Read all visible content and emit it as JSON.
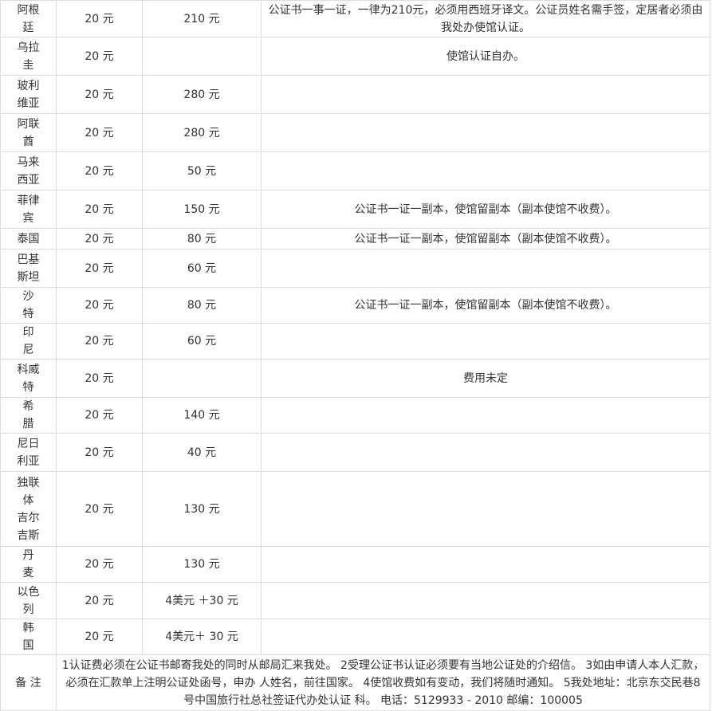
{
  "rows": [
    {
      "country": "阿根廷",
      "fee": "20 元",
      "embassy_fee": "210 元",
      "note": "公证书一事一证，一律为210元，必须用西班牙译文。公证员姓名需手签，定居者必须由我处办使馆认证。"
    },
    {
      "country": "乌拉圭",
      "fee": "20 元",
      "embassy_fee": "",
      "note": "使馆认证自办。"
    },
    {
      "country": "玻利维亚",
      "fee": "20 元",
      "embassy_fee": "280 元",
      "note": ""
    },
    {
      "country": "阿联酋",
      "fee": "20 元",
      "embassy_fee": "280 元",
      "note": ""
    },
    {
      "country": "马来西亚",
      "fee": "20 元",
      "embassy_fee": "50 元",
      "note": ""
    },
    {
      "country": "菲律宾",
      "fee": "20 元",
      "embassy_fee": "150 元",
      "note": "公证书一证一副本，使馆留副本（副本使馆不收费）。"
    },
    {
      "country": "泰国",
      "fee": "20 元",
      "embassy_fee": "80 元",
      "note": "公证书一证一副本，使馆留副本（副本使馆不收费）。"
    },
    {
      "country": "巴基斯坦",
      "fee": "20 元",
      "embassy_fee": "60 元",
      "note": ""
    },
    {
      "country": "沙 特",
      "fee": "20 元",
      "embassy_fee": "80 元",
      "note": "公证书一证一副本，使馆留副本（副本使馆不收费）。"
    },
    {
      "country": "印 尼",
      "fee": "20 元",
      "embassy_fee": "60 元",
      "note": ""
    },
    {
      "country": "科威特",
      "fee": "20 元",
      "embassy_fee": "",
      "note": "费用未定"
    },
    {
      "country": "希 腊",
      "fee": "20 元",
      "embassy_fee": "140 元",
      "note": ""
    },
    {
      "country": "尼日利亚",
      "fee": "20 元",
      "embassy_fee": "40 元",
      "note": ""
    },
    {
      "country": "独联体 吉尔吉斯",
      "fee": "20 元",
      "embassy_fee": "130 元",
      "note": ""
    },
    {
      "country": "丹 麦",
      "fee": "20 元",
      "embassy_fee": "130 元",
      "note": ""
    },
    {
      "country": "以色列",
      "fee": "20 元",
      "embassy_fee": "4美元 ＋30 元",
      "note": ""
    },
    {
      "country": "韩 国",
      "fee": "20 元",
      "embassy_fee": "4美元＋ 30 元",
      "note": ""
    }
  ],
  "remarks": {
    "label": "备 注",
    "text": "1认证费必须在公证书邮寄我处的同时从邮局汇来我处。 2受理公证书认证必须要有当地公证处的介绍信。 3如由申请人本人汇款，必须在汇款单上注明公证处函号，申办 人姓名，前往国家。 4使馆收费如有变动，我们将随时通知。 5我处地址：北京东交民巷8号中国旅行社总社签证代办处认证 科。 电话：5129933 - 2010 邮编：100005"
  }
}
